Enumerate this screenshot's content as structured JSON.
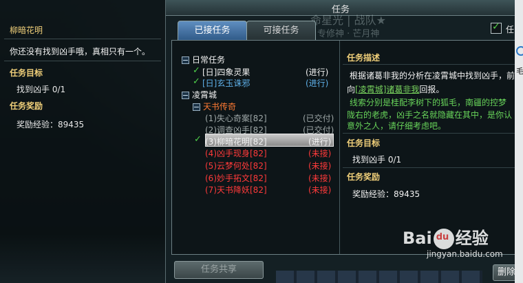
{
  "window": {
    "title": "任务"
  },
  "background_text": [
    "命星光 | 战队★",
    "专修神 · 芒月神"
  ],
  "side_panel": {
    "quest_name": "柳暗花明",
    "dialog": "你还没有找到凶手哦，真相只有一个。",
    "objective_header": "任务目标",
    "objective": "找到凶手 0/1",
    "reward_header": "任务奖励",
    "reward": "奖励经验：89435"
  },
  "tabs": [
    {
      "label": "已接任务",
      "active": true
    },
    {
      "label": "可接任务",
      "active": false
    }
  ],
  "top_filter": {
    "checked": true,
    "label": "任"
  },
  "quest_list": {
    "daily": {
      "header": "日常任务",
      "items": [
        {
          "name": "[日]四象灵果",
          "status": "(进行)",
          "checked": true,
          "color": "white"
        },
        {
          "name": "[日]玄玉诛邪",
          "status": "(进行)",
          "checked": true,
          "color": "blue"
        }
      ]
    },
    "city": {
      "header": "凌霄城",
      "sub_header": "天书传奇",
      "items": [
        {
          "name": "(1)失心奇案[82]",
          "status": "(已交付)",
          "color": "grey"
        },
        {
          "name": "(2)调查凶手[82]",
          "status": "(已交付)",
          "color": "grey"
        },
        {
          "name": "(3)柳暗花明[82]",
          "status": "(进行)",
          "checked": true,
          "selected": true,
          "color": "white"
        },
        {
          "name": "(4)凶手现身[82]",
          "status": "(未接)",
          "color": "red"
        },
        {
          "name": "(5)云梦何处[82]",
          "status": "(未接)",
          "color": "red"
        },
        {
          "name": "(6)妙手拓文[82]",
          "status": "(未接)",
          "color": "red"
        },
        {
          "name": "(7)天书降妖[82]",
          "status": "(未接)",
          "color": "red"
        }
      ]
    }
  },
  "detail": {
    "desc_header": "任务描述",
    "desc_line1": "根据诸葛非我的分析在凌霄城中找到凶手，前",
    "desc_line2_pre": "向",
    "desc_link": "[凌霄城]诸葛非我",
    "desc_line2_post": "回报。",
    "desc_line3": "线索分别是桂配李树下的狐毛，南疆的控梦",
    "desc_line4": "陇右的老虎，凶手之名就隐藏在其中，是你认",
    "desc_line5": "意外之人，请仔细考虑吧。",
    "objective_header": "任务目标",
    "objective": "找到凶手 0/1",
    "reward_header": "任务奖励",
    "reward": "奖励经验：89435"
  },
  "buttons": {
    "share": "任务共享",
    "delete": "删除"
  },
  "watermark": {
    "logo_left": "Bai",
    "logo_right": "经验",
    "url": "jingyan.baidu.com"
  },
  "edge": {
    "char": "毛"
  }
}
